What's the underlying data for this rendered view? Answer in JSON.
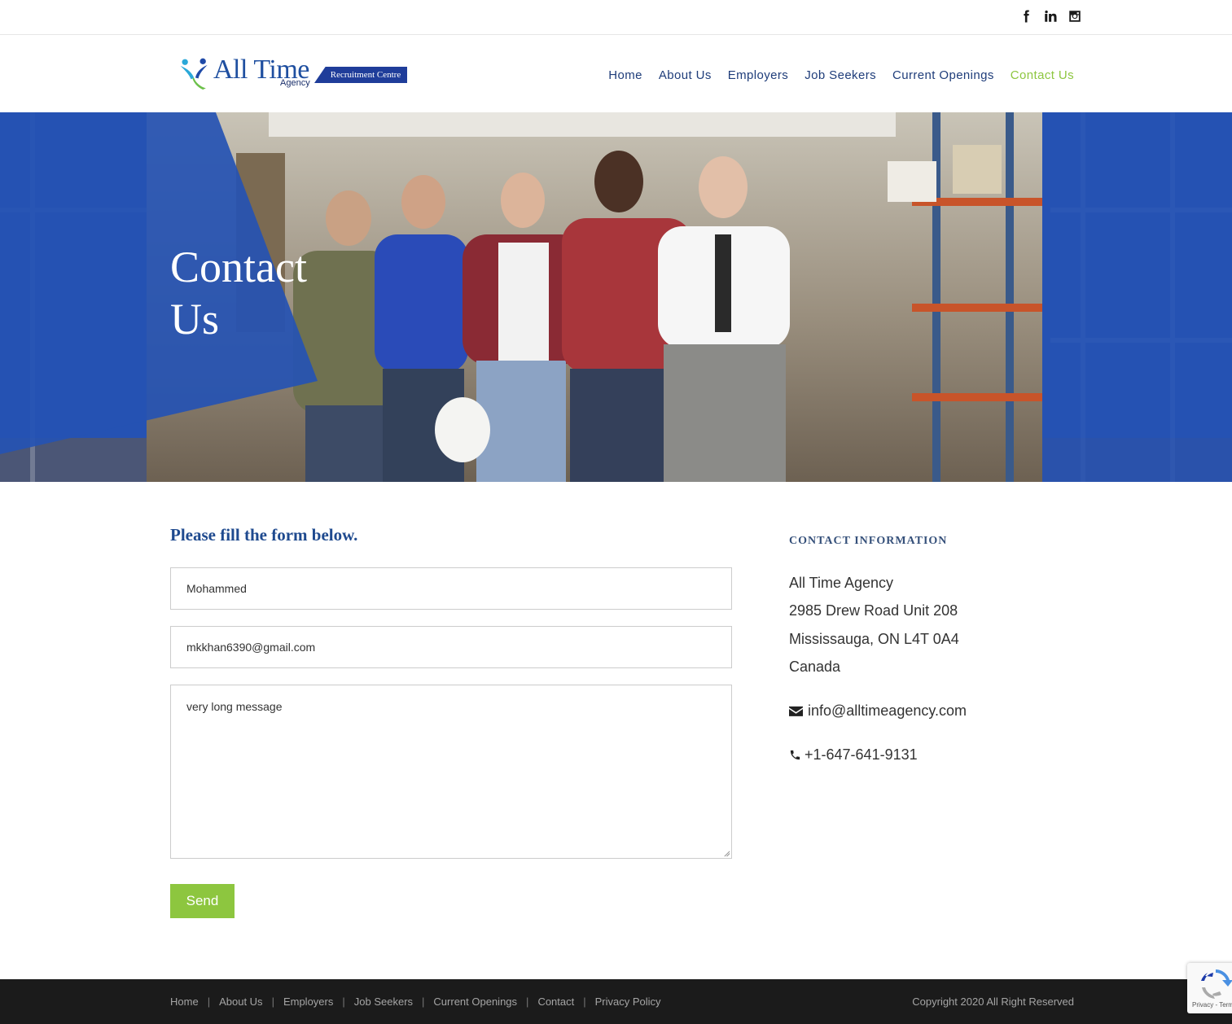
{
  "social": {
    "icons": [
      "facebook-icon",
      "linkedin-icon",
      "instagram-icon"
    ]
  },
  "logo": {
    "main": "All Time",
    "sub": "Agency",
    "band": "Recruitment Centre"
  },
  "nav": [
    {
      "label": "Home",
      "active": false
    },
    {
      "label": "About Us",
      "active": false
    },
    {
      "label": "Employers",
      "active": false
    },
    {
      "label": "Job Seekers",
      "active": false
    },
    {
      "label": "Current Openings",
      "active": false
    },
    {
      "label": "Contact Us",
      "active": true
    }
  ],
  "hero": {
    "title": "Contact Us"
  },
  "form": {
    "title": "Please fill the form below.",
    "name_value": "Mohammed",
    "email_value": "mkkhan6390@gmail.com",
    "message_value": "very long message",
    "send_label": "Send"
  },
  "contact": {
    "title": "CONTACT INFORMATION",
    "company": "All Time Agency",
    "address1": "2985 Drew Road Unit 208",
    "address2": "Mississauga, ON L4T 0A4",
    "country": "Canada",
    "email": "info@alltimeagency.com",
    "phone": "+1-647-641-9131"
  },
  "footer": {
    "links": [
      "Home",
      "About Us",
      "Employers",
      "Job Seekers",
      "Current Openings",
      "Contact",
      "Privacy Policy"
    ],
    "copyright": "Copyright 2020 All Right Reserved"
  },
  "recaptcha": {
    "text": "Privacy - Terms"
  },
  "colors": {
    "brand_blue": "#1f4aa8",
    "accent_green": "#8dc63f",
    "nav_text": "#1f3d7a",
    "footer_bg": "#1b1b1b"
  }
}
